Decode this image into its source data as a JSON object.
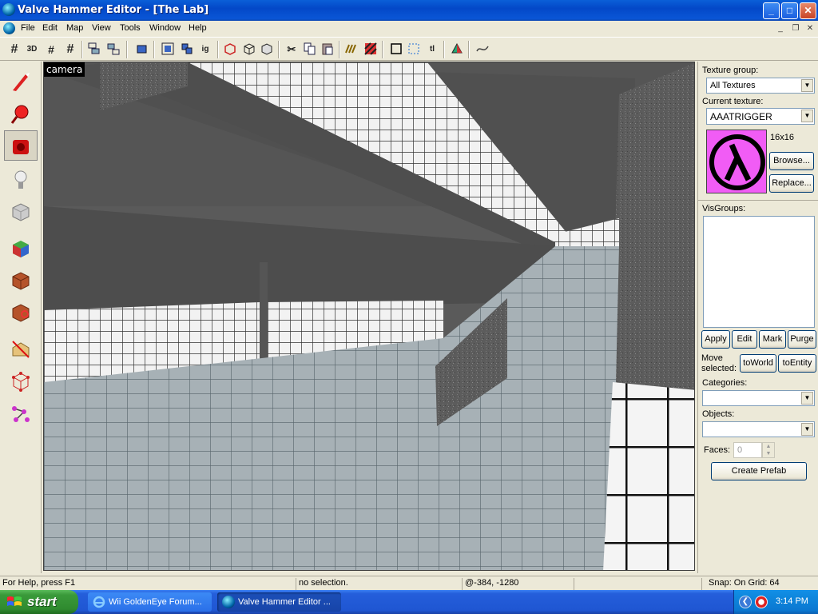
{
  "window": {
    "title": "Valve Hammer Editor - [The Lab]",
    "minimize": "_",
    "maximize": "□",
    "close": "✕"
  },
  "menu": [
    "File",
    "Edit",
    "Map",
    "View",
    "Tools",
    "Window",
    "Help"
  ],
  "mdi": {
    "minimize": "_",
    "restore": "❐",
    "close": "✕"
  },
  "toolbar": {
    "grid": "#",
    "3d": "3D",
    "grid_small": "#",
    "grid_add": "#",
    "ig": "ig",
    "tl": "tl"
  },
  "viewport": {
    "label": "camera"
  },
  "panel": {
    "texture_group_label": "Texture group:",
    "texture_group_value": "All Textures",
    "current_texture_label": "Current texture:",
    "current_texture_value": "AAATRIGGER",
    "texture_size": "16x16",
    "browse": "Browse...",
    "replace": "Replace...",
    "visgroups_label": "VisGroups:",
    "apply": "Apply",
    "edit": "Edit",
    "mark": "Mark",
    "purge": "Purge",
    "move_selected_line1": "Move",
    "move_selected_line2": "selected:",
    "to_world": "toWorld",
    "to_entity": "toEntity",
    "categories_label": "Categories:",
    "objects_label": "Objects:",
    "faces_label": "Faces:",
    "faces_value": "0",
    "create_prefab": "Create Prefab"
  },
  "status": {
    "help": "For Help, press F1",
    "selection": "no selection.",
    "coords": "@-384, -1280",
    "snap": "Snap: On Grid: 64"
  },
  "taskbar": {
    "start": "start",
    "tasks": [
      {
        "label": "Wii GoldenEye Forum...",
        "icon": "ie-icon"
      },
      {
        "label": "Valve Hammer Editor ...",
        "icon": "hammer-icon",
        "active": true
      }
    ],
    "clock": "3:14 PM"
  }
}
